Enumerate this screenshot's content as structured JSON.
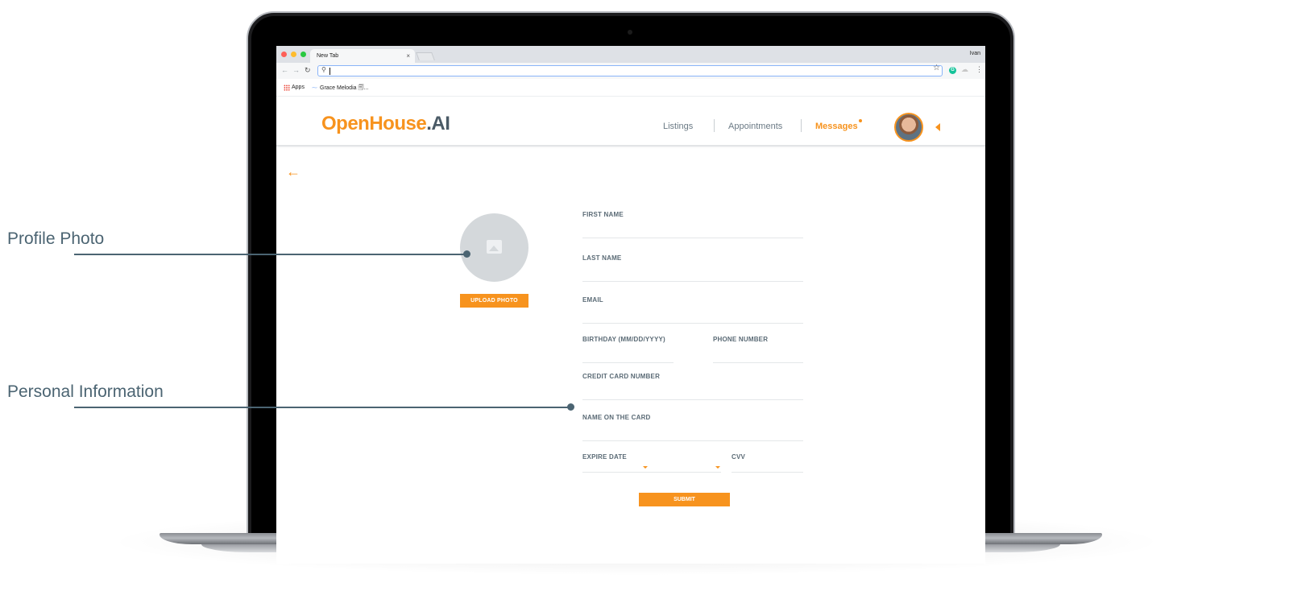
{
  "browser": {
    "tab_title": "New Tab",
    "tab_close": "×",
    "user": "Ivan",
    "bookmarks": [
      "Apps",
      "Grace Melodia 🗐..."
    ]
  },
  "app": {
    "logo_primary": "OpenHouse",
    "logo_secondary": ".AI",
    "nav": {
      "listings": "Listings",
      "appointments": "Appointments",
      "messages": "Messages"
    },
    "accent_color": "#f7931e",
    "text_color": "#4a5a66"
  },
  "form": {
    "upload_photo": "UPLOAD PHOTO",
    "first_name": "FIRST NAME",
    "last_name": "LAST NAME",
    "email": "EMAIL",
    "birthday": "BIRTHDAY (MM/DD/YYYY)",
    "phone": "PHONE NUMBER",
    "credit_card": "CREDIT CARD NUMBER",
    "name_on_card": "NAME ON THE CARD",
    "expire_date": "EXPIRE DATE",
    "cvv": "CVV",
    "submit": "SUBMIT"
  },
  "callouts": {
    "profile_photo": "Profile Photo",
    "personal_information": "Personal Information"
  }
}
